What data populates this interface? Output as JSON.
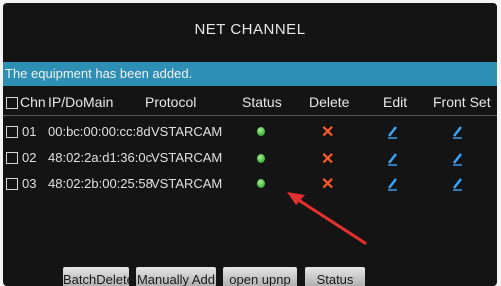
{
  "window": {
    "title": "NET CHANNEL"
  },
  "banner": {
    "message": "The equipment has been added."
  },
  "table": {
    "headers": {
      "chn": "Chn",
      "ip": "IP/DoMain",
      "protocol": "Protocol",
      "status": "Status",
      "delete": "Delete",
      "edit": "Edit",
      "front_set": "Front Set"
    },
    "rows": [
      {
        "chn": "01",
        "ip": "00:bc:00:00:cc:8d",
        "protocol": "VSTARCAM",
        "status": "online"
      },
      {
        "chn": "02",
        "ip": "48:02:2a:d1:36:0c",
        "protocol": "VSTARCAM",
        "status": "online"
      },
      {
        "chn": "03",
        "ip": "48:02:2b:00:25:58",
        "protocol": "VSTARCAM",
        "status": "online"
      }
    ]
  },
  "buttons": {
    "batch_delete": "BatchDelete",
    "manually_add": "Manually Add",
    "open_upnp": "open upnp",
    "status": "Status"
  },
  "colors": {
    "banner": "#2e8fb5",
    "status_online": "#38b43a",
    "delete_icon": "#ff5a2a",
    "edit_icon": "#3aa7ff",
    "annotation_arrow": "#e53030"
  },
  "icons": {
    "status": "status-dot-icon",
    "delete": "delete-x-icon",
    "edit": "pencil-icon",
    "front_set": "pencil-icon"
  }
}
